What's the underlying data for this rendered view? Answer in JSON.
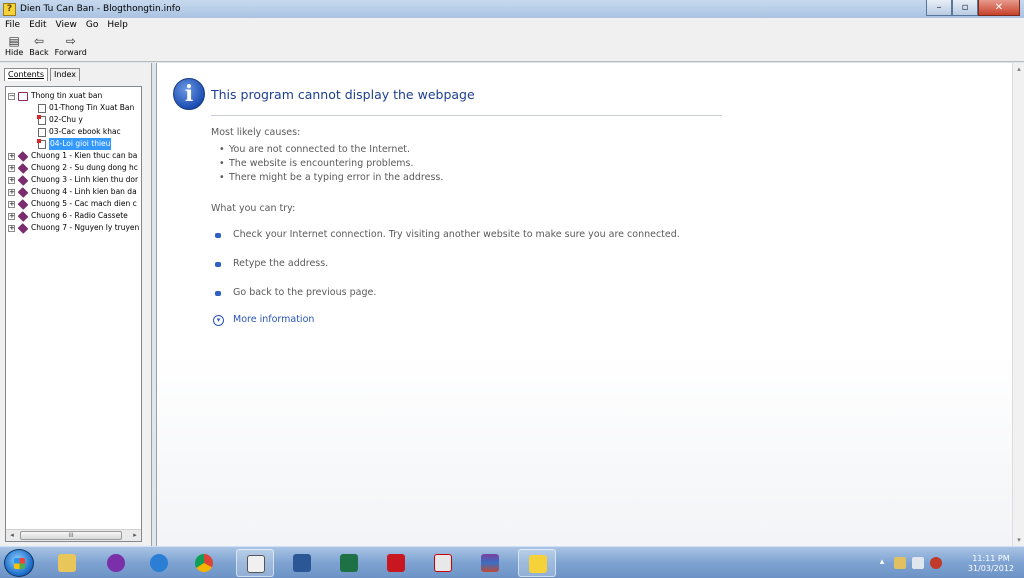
{
  "window": {
    "title": "Dien Tu Can Ban - Blogthongtin.info",
    "app_icon": "help-question-icon"
  },
  "menu": [
    "File",
    "Edit",
    "View",
    "Go",
    "Help"
  ],
  "toolbar": [
    {
      "label": "Hide",
      "icon": "hide-pane-icon"
    },
    {
      "label": "Back",
      "icon": "back-arrow-icon"
    },
    {
      "label": "Forward",
      "icon": "forward-arrow-icon"
    }
  ],
  "tabs": {
    "contents": "Contents",
    "index": "Index"
  },
  "tree": {
    "root": "Thong tin xuat ban",
    "children": [
      "01-Thong Tin Xuat Ban",
      "02-Chu y",
      "03-Cac ebook khac",
      "04-Loi gioi thieu"
    ],
    "selected": "04-Loi gioi thieu",
    "chapters": [
      "Chuong 1 - Kien thuc can ba",
      "Chuong 2 - Su dung dong hc",
      "Chuong 3 - Linh kien thu dor",
      "Chuong 4 - Linh kien ban da",
      "Chuong 5 - Cac mach dien c",
      "Chuong 6 - Radio Cassete",
      "Chuong 7 - Nguyen ly truyen"
    ],
    "scroll_thumb": "III"
  },
  "error_page": {
    "title": "This program cannot display the webpage",
    "causes_heading": "Most likely causes:",
    "causes": [
      "You are not connected to the Internet.",
      "The website is encountering problems.",
      "There might be a typing error in the address."
    ],
    "try_heading": "What you can try:",
    "try_items": [
      "Check your Internet connection. Try visiting another website to make sure you are connected.",
      "Retype the address.",
      "Go back to the previous page."
    ],
    "more_info": "More information"
  },
  "taskbar": {
    "apps": [
      "explorer-folder-icon",
      "yahoo-messenger-icon",
      "internet-explorer-icon",
      "chrome-icon",
      "mspaint-icon",
      "word-icon",
      "excel-icon",
      "acrobat-icon",
      "unikey-icon",
      "winrar-icon",
      "help-file-icon"
    ],
    "clock_time": "11:11 PM",
    "clock_date": "31/03/2012"
  },
  "colors": {
    "accent": "#1e3f8f",
    "link": "#2a55b5",
    "selection": "#3399ff"
  }
}
